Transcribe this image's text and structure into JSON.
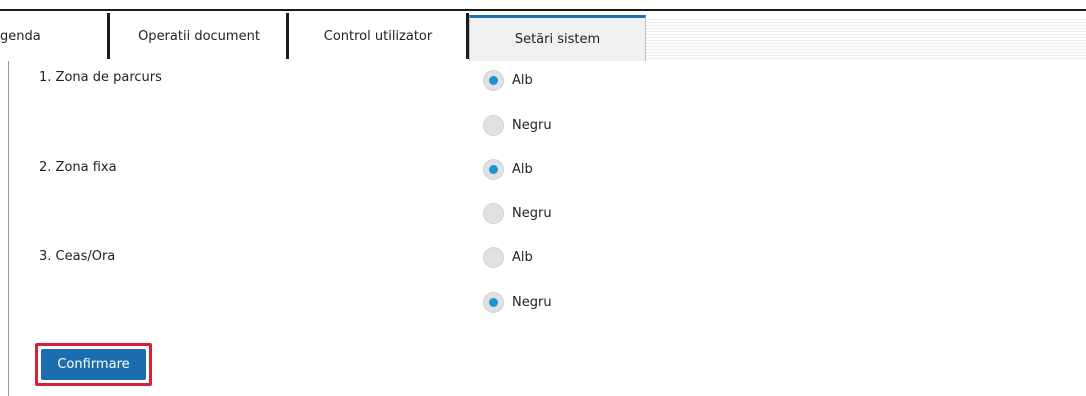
{
  "tabs": [
    {
      "label": "genda",
      "active": false
    },
    {
      "label": "Operatii document",
      "active": false
    },
    {
      "label": "Control utilizator",
      "active": false
    },
    {
      "label": "Setări sistem",
      "active": true
    }
  ],
  "settings": [
    {
      "label": "1. Zona de parcurs",
      "options": [
        {
          "label": "Alb",
          "checked": true
        },
        {
          "label": "Negru",
          "checked": false
        }
      ]
    },
    {
      "label": "2. Zona fixa",
      "options": [
        {
          "label": "Alb",
          "checked": true
        },
        {
          "label": "Negru",
          "checked": false
        }
      ]
    },
    {
      "label": "3. Ceas/Ora",
      "options": [
        {
          "label": "Alb",
          "checked": false
        },
        {
          "label": "Negru",
          "checked": true
        }
      ]
    }
  ],
  "confirm": {
    "label": "Confirmare"
  },
  "colors": {
    "accent": "#1c6db0",
    "radio_selected": "#1a92d6",
    "highlight": "#d6203c"
  }
}
